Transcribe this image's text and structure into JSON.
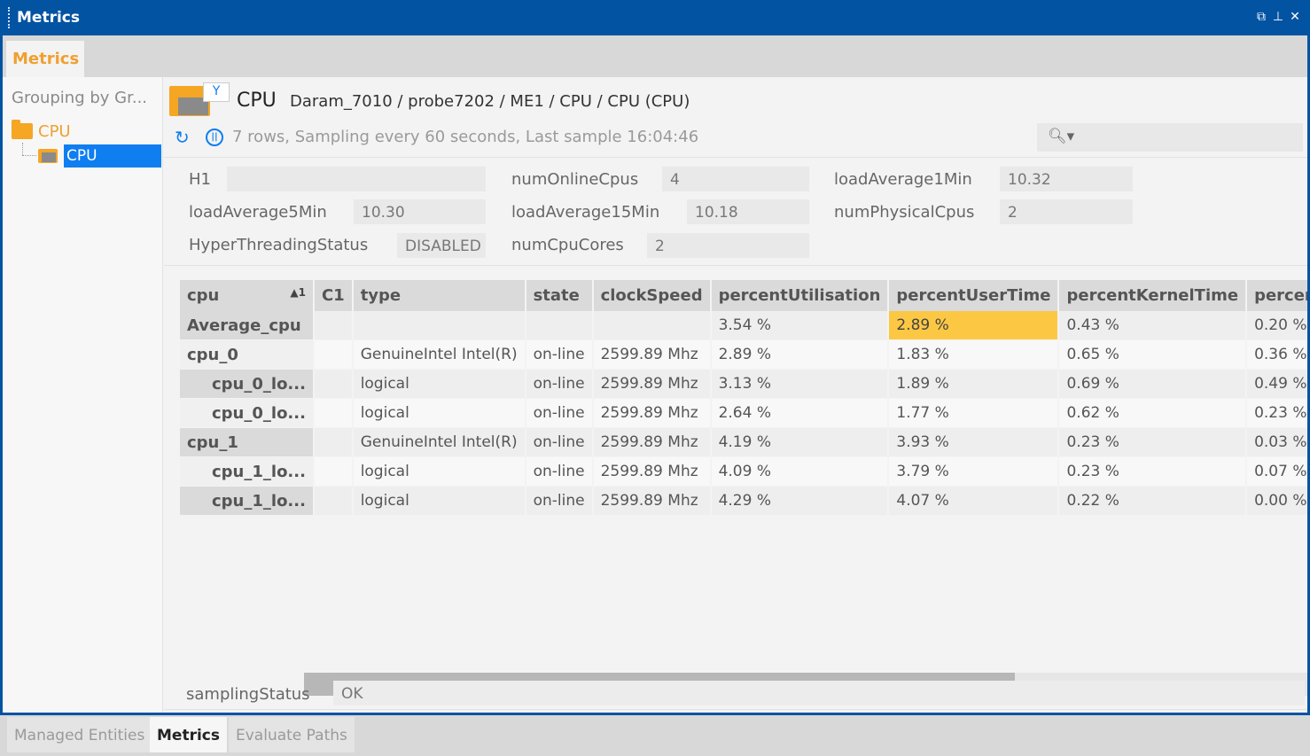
{
  "window": {
    "title": "Metrics",
    "controls": [
      "⧉",
      "⊥",
      "✕"
    ]
  },
  "top_tab": {
    "label": "Metrics"
  },
  "tree": {
    "grouping_label": "Grouping by Gr...",
    "root": "CPU",
    "child": "CPU"
  },
  "header": {
    "title": "CPU",
    "path": "Daram_7010 / probe7202 / ME1 / CPU / CPU (CPU)",
    "sampling": "7 rows, Sampling every 60 seconds, Last sample 16:04:46",
    "search_icon": "magnifier-dropdown-icon",
    "search_placeholder": ""
  },
  "fields": {
    "h1": {
      "label": "H1",
      "value": ""
    },
    "numOnlineCpus": {
      "label": "numOnlineCpus",
      "value": "4"
    },
    "loadAverage1Min": {
      "label": "loadAverage1Min",
      "value": "10.32"
    },
    "loadAverage5Min": {
      "label": "loadAverage5Min",
      "value": "10.30"
    },
    "loadAverage15Min": {
      "label": "loadAverage15Min",
      "value": "10.18"
    },
    "numPhysicalCpus": {
      "label": "numPhysicalCpus",
      "value": "2"
    },
    "hyperThreadingStatus": {
      "label": "HyperThreadingStatus",
      "value": "DISABLED"
    },
    "numCpuCores": {
      "label": "numCpuCores",
      "value": "2"
    },
    "samplingStatus": {
      "label": "samplingStatus",
      "value": "OK"
    }
  },
  "table": {
    "sort_indicator": "▲1",
    "columns": [
      "cpu",
      "C1",
      "type",
      "state",
      "clockSpeed",
      "percentUtilisation",
      "percentUserTime",
      "percentKernelTime",
      "percentWai"
    ],
    "rows": [
      [
        "Average_cpu",
        "",
        "",
        "",
        "",
        "3.54 %",
        "2.89 %",
        "0.43 %",
        "0.20 %"
      ],
      [
        "cpu_0",
        "",
        "GenuineIntel Intel(R)",
        "on-line",
        "2599.89 Mhz",
        "2.89 %",
        "1.83 %",
        "0.65 %",
        "0.36 %"
      ],
      [
        "cpu_0_lo...",
        "",
        "logical",
        "on-line",
        "2599.89 Mhz",
        "3.13 %",
        "1.89 %",
        "0.69 %",
        "0.49 %"
      ],
      [
        "cpu_0_lo...",
        "",
        "logical",
        "on-line",
        "2599.89 Mhz",
        "2.64 %",
        "1.77 %",
        "0.62 %",
        "0.23 %"
      ],
      [
        "cpu_1",
        "",
        "GenuineIntel Intel(R)",
        "on-line",
        "2599.89 Mhz",
        "4.19 %",
        "3.93 %",
        "0.23 %",
        "0.03 %"
      ],
      [
        "cpu_1_lo...",
        "",
        "logical",
        "on-line",
        "2599.89 Mhz",
        "4.09 %",
        "3.79 %",
        "0.23 %",
        "0.07 %"
      ],
      [
        "cpu_1_lo...",
        "",
        "logical",
        "on-line",
        "2599.89 Mhz",
        "4.29 %",
        "4.07 %",
        "0.22 %",
        "0.00 %"
      ]
    ],
    "highlight_color": "#fcc844"
  },
  "bottom_tabs": [
    "Managed Entities",
    "Metrics",
    "Evaluate Paths"
  ],
  "colors": {
    "titlebar": "#0353a3",
    "accent": "#f0a030",
    "selection": "#0f7ef0"
  }
}
